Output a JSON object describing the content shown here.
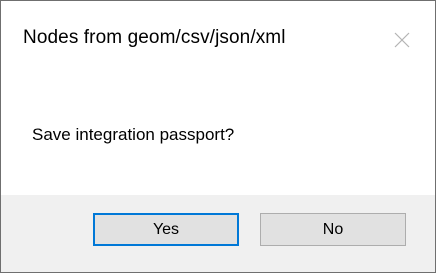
{
  "window": {
    "title": "Nodes from geom/csv/json/xml",
    "close_icon": "close-icon"
  },
  "message": {
    "text": "Save integration passport?"
  },
  "buttons": {
    "yes_label": "Yes",
    "no_label": "No",
    "focused": "yes"
  },
  "colors": {
    "footer_background": "#f0f0f0",
    "focus_accent": "#0078d7",
    "button_face": "#e1e1e1"
  }
}
